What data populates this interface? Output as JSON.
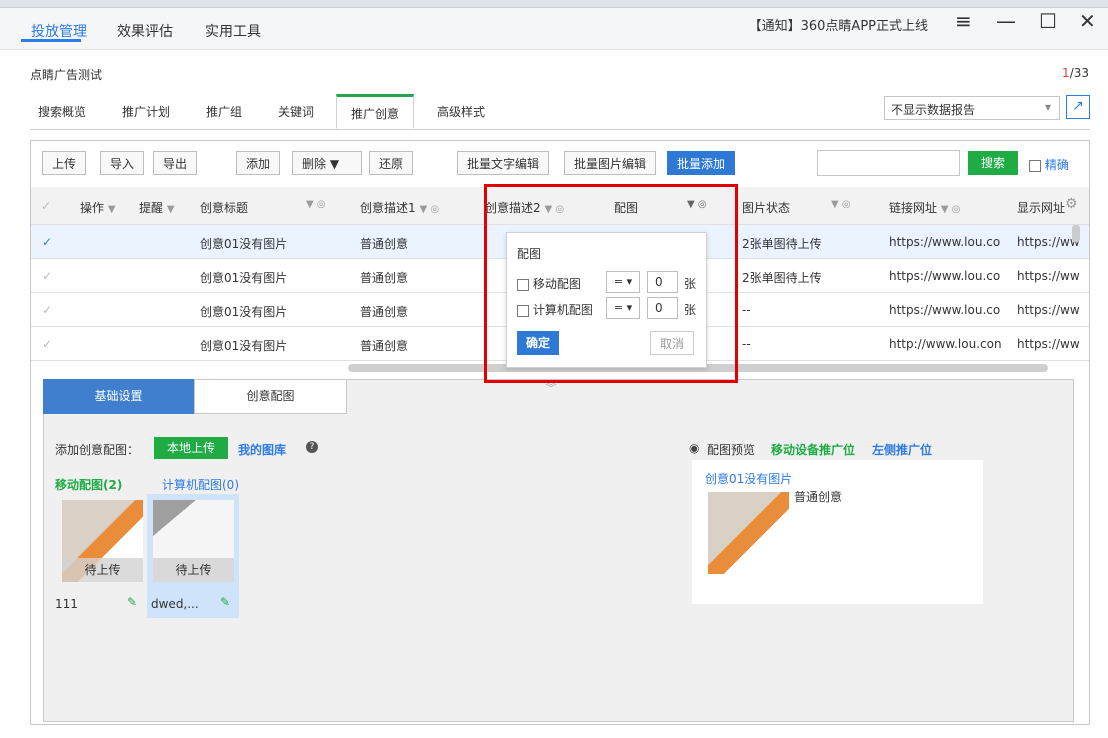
{
  "app": {
    "main_tabs": [
      "投放管理",
      "效果评估",
      "实用工具"
    ],
    "notice": "【通知】360点睛APP正式上线",
    "window_buttons": [
      "≡",
      "—",
      "☐",
      "✕"
    ]
  },
  "account": {
    "name": "点睛广告测试",
    "page_current": "1",
    "page_total": "/33"
  },
  "sub_tabs": [
    "搜索概览",
    "推广计划",
    "推广组",
    "关键词",
    "推广创意",
    "高级样式"
  ],
  "report_select": "不显示数据报告",
  "toolbar": {
    "buttons": [
      "上传",
      "导入",
      "导出",
      "添加",
      "删除",
      "还原",
      "批量文字编辑",
      "批量图片编辑",
      "批量添加"
    ],
    "search_label": "搜索",
    "exact_label": "精确"
  },
  "table": {
    "headers": [
      "操作",
      "提醒",
      "创意标题",
      "创意描述1",
      "创意描述2",
      "配图",
      "图片状态",
      "链接网址",
      "显示网址"
    ],
    "rows": [
      {
        "title": "创意01没有图片",
        "desc1": "普通创意",
        "status": "2张单图待上传",
        "url": "https://www.lou.co",
        "display": "https://ww"
      },
      {
        "title": "创意01没有图片",
        "desc1": "普通创意",
        "status": "2张单图待上传",
        "url": "https://www.lou.co",
        "display": "https://ww"
      },
      {
        "title": "创意01没有图片",
        "desc1": "普通创意",
        "status": "--",
        "url": "https://www.lou.co",
        "display": "https://ww"
      },
      {
        "title": "创意01没有图片",
        "desc1": "普通创意",
        "status": "--",
        "url": "http://www.lou.con",
        "display": "https://ww"
      }
    ]
  },
  "filter_popup": {
    "title": "配图",
    "mobile_label": "移动配图",
    "computer_label": "计算机配图",
    "operator": "=",
    "mobile_value": "0",
    "computer_value": "0",
    "unit": "张",
    "confirm": "确定",
    "cancel": "取消"
  },
  "bottom": {
    "tabs": [
      "基础设置",
      "创意配图"
    ],
    "add_label": "添加创意配图：",
    "local_upload": "本地上传",
    "gallery": "我的图库",
    "mobile_count": "移动配图(2)",
    "computer_count": "计算机配图(0)",
    "images": [
      {
        "status": "待上传",
        "name": "111"
      },
      {
        "status": "待上传",
        "name": "dwed,..."
      }
    ],
    "preview_label": "配图预览",
    "mobile_slot": "移动设备推广位",
    "left_slot": "左侧推广位",
    "preview_title": "创意01没有图片",
    "preview_desc": "普通创意"
  },
  "colors": {
    "accent_blue": "#2d7be4",
    "green": "#1fac45",
    "red_box": "#e20000"
  }
}
